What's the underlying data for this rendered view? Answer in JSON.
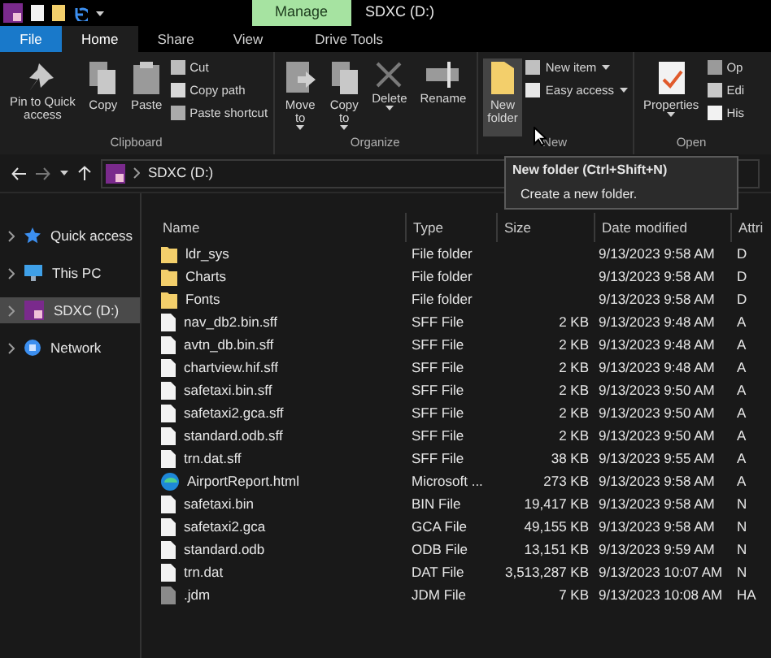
{
  "title_bar": {
    "context_tab": "Manage",
    "title": "SDXC (D:)"
  },
  "tabs": [
    {
      "label": "File",
      "kind": "file",
      "selected": false
    },
    {
      "label": "Home",
      "kind": "tab",
      "selected": true
    },
    {
      "label": "Share",
      "kind": "tab",
      "selected": false
    },
    {
      "label": "View",
      "kind": "tab",
      "selected": false
    },
    {
      "label": "Drive Tools",
      "kind": "tab",
      "selected": false
    }
  ],
  "ribbon": [
    {
      "label": "Clipboard",
      "items": [
        {
          "kind": "large",
          "label": "Pin to Quick\naccess",
          "dropdown": false,
          "highlighted": false
        },
        {
          "kind": "large",
          "label": "Copy",
          "dropdown": false,
          "highlighted": false
        },
        {
          "kind": "large",
          "label": "Paste",
          "dropdown": false,
          "highlighted": false
        },
        {
          "kind": "stack",
          "items": [
            {
              "label": "Cut",
              "dropdown": false
            },
            {
              "label": "Copy path",
              "dropdown": false
            },
            {
              "label": "Paste shortcut",
              "dropdown": false
            }
          ]
        }
      ]
    },
    {
      "label": "Organize",
      "items": [
        {
          "kind": "large",
          "label": "Move\nto",
          "dropdown": true,
          "highlighted": false
        },
        {
          "kind": "large",
          "label": "Copy\nto",
          "dropdown": true,
          "highlighted": false
        },
        {
          "kind": "large",
          "label": "Delete",
          "dropdown": true,
          "highlighted": false
        },
        {
          "kind": "large",
          "label": "Rename",
          "dropdown": false,
          "highlighted": false
        }
      ]
    },
    {
      "label": "New",
      "items": [
        {
          "kind": "large",
          "label": "New\nfolder",
          "dropdown": false,
          "highlighted": true
        },
        {
          "kind": "stack",
          "items": [
            {
              "label": "New item",
              "dropdown": true
            },
            {
              "label": "Easy access",
              "dropdown": true
            }
          ]
        }
      ]
    },
    {
      "label": "Open",
      "items": [
        {
          "kind": "large",
          "label": "Properties",
          "dropdown": true,
          "highlighted": false
        },
        {
          "kind": "stack",
          "items": [
            {
              "label": "Op",
              "dropdown": false
            },
            {
              "label": "Edi",
              "dropdown": false
            },
            {
              "label": "His",
              "dropdown": false
            }
          ]
        }
      ]
    }
  ],
  "address_bar": {
    "path": "SDXC (D:)"
  },
  "tooltip": {
    "title": "New folder (Ctrl+Shift+N)",
    "text": "Create a new folder."
  },
  "sidebar": {
    "items": [
      {
        "label": "Quick access",
        "selected": false
      },
      {
        "label": "This PC",
        "selected": false
      },
      {
        "label": "SDXC (D:)",
        "selected": true
      },
      {
        "label": "Network",
        "selected": false
      }
    ]
  },
  "table": {
    "columns": [
      "Name",
      "Type",
      "Size",
      "Date modified",
      "Attri"
    ],
    "rows": [
      {
        "kind": "folder",
        "name": "ldr_sys",
        "type": "File folder",
        "date": "9/13/2023 9:58 AM",
        "attributes": "D"
      },
      {
        "kind": "folder",
        "name": "Charts",
        "type": "File folder",
        "date": "9/13/2023 9:58 AM",
        "attributes": "D"
      },
      {
        "kind": "folder",
        "name": "Fonts",
        "type": "File folder",
        "date": "9/13/2023 9:58 AM",
        "attributes": "D"
      },
      {
        "kind": "file",
        "name": "nav_db2.bin.sff",
        "type": "SFF File",
        "size": "2 KB",
        "date": "9/13/2023 9:48 AM",
        "attributes": "A"
      },
      {
        "kind": "file",
        "name": "avtn_db.bin.sff",
        "type": "SFF File",
        "size": "2 KB",
        "date": "9/13/2023 9:48 AM",
        "attributes": "A"
      },
      {
        "kind": "file",
        "name": "chartview.hif.sff",
        "type": "SFF File",
        "size": "2 KB",
        "date": "9/13/2023 9:48 AM",
        "attributes": "A"
      },
      {
        "kind": "file",
        "name": "safetaxi.bin.sff",
        "type": "SFF File",
        "size": "2 KB",
        "date": "9/13/2023 9:50 AM",
        "attributes": "A"
      },
      {
        "kind": "file",
        "name": "safetaxi2.gca.sff",
        "type": "SFF File",
        "size": "2 KB",
        "date": "9/13/2023 9:50 AM",
        "attributes": "A"
      },
      {
        "kind": "file",
        "name": "standard.odb.sff",
        "type": "SFF File",
        "size": "2 KB",
        "date": "9/13/2023 9:50 AM",
        "attributes": "A"
      },
      {
        "kind": "file",
        "name": "trn.dat.sff",
        "type": "SFF File",
        "size": "38 KB",
        "date": "9/13/2023 9:55 AM",
        "attributes": "A"
      },
      {
        "kind": "web",
        "name": "AirportReport.html",
        "type": "Microsoft ...",
        "size": "273 KB",
        "date": "9/13/2023 9:58 AM",
        "attributes": "A"
      },
      {
        "kind": "file",
        "name": "safetaxi.bin",
        "type": "BIN File",
        "size": "19,417 KB",
        "date": "9/13/2023 9:58 AM",
        "attributes": "N"
      },
      {
        "kind": "file",
        "name": "safetaxi2.gca",
        "type": "GCA File",
        "size": "49,155 KB",
        "date": "9/13/2023 9:58 AM",
        "attributes": "N"
      },
      {
        "kind": "file",
        "name": "standard.odb",
        "type": "ODB File",
        "size": "13,151 KB",
        "date": "9/13/2023 9:59 AM",
        "attributes": "N"
      },
      {
        "kind": "file",
        "name": "trn.dat",
        "type": "DAT File",
        "size": "3,513,287 KB",
        "date": "9/13/2023 10:07 AM",
        "attributes": "N"
      },
      {
        "kind": "hidden",
        "name": ".jdm",
        "type": "JDM File",
        "size": "7 KB",
        "date": "9/13/2023 10:08 AM",
        "attributes": "HA"
      }
    ]
  }
}
